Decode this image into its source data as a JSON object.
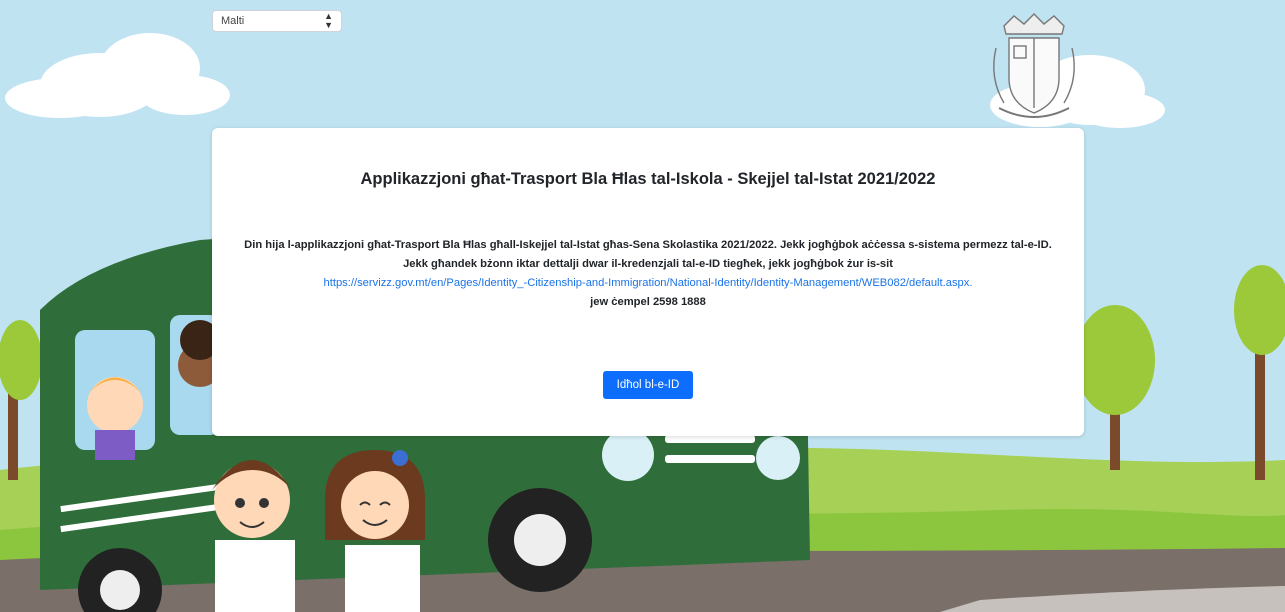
{
  "language_select": {
    "value": "Malti"
  },
  "card": {
    "title": "Applikazzjoni għat-Trasport Bla Ħlas tal-Iskola - Skejjel tal-Istat 2021/2022",
    "description": "Din hija l-applikazzjoni għat-Trasport Bla Ħlas għall-Iskejjel tal-Istat għas-Sena Skolastika 2021/2022. Jekk jogħġbok aċċessa s-sistema permezz tal-e-ID. Jekk għandek bżonn iktar dettalji dwar il-kredenzjali tal-e-ID tiegħek, jekk jogħġbok żur is-sit",
    "link": "https://servizz.gov.mt/en/Pages/Identity_-Citizenship-and-Immigration/National-Identity/Identity-Management/WEB082/default.aspx.",
    "phone": "jew ċempel 2598 1888",
    "login_button": "Idħol bl-e-ID"
  },
  "colors": {
    "sky": "#bfe3f1",
    "grass": "#8cc63f",
    "bus": "#2f6e3a",
    "primary_button": "#0d6efd",
    "link": "#1a73e8"
  },
  "icons": {
    "crest": "malta-coat-of-arms-icon",
    "select_arrows": "sort-arrows-icon"
  }
}
